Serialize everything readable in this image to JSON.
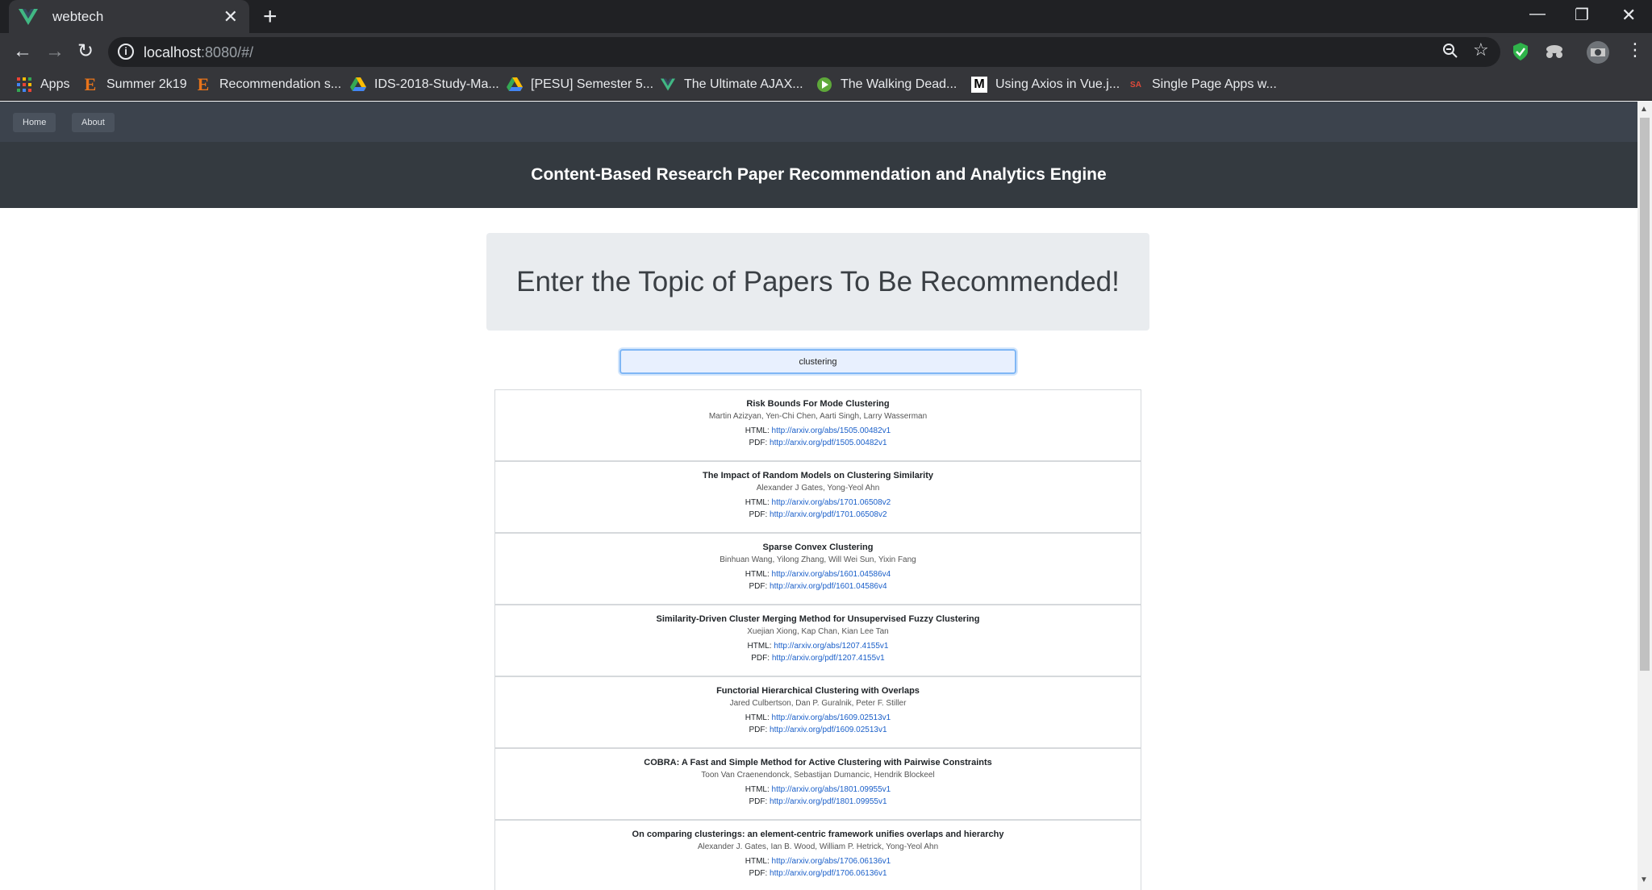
{
  "browser": {
    "tab_title": "webtech",
    "new_tab": "+",
    "tab_close": "✕",
    "url_host": "localhost",
    "url_rest": ":8080/#/",
    "bookmarks": [
      {
        "label": "Apps",
        "icon": "apps-grid-icon"
      },
      {
        "label": "Summer 2k19",
        "icon": "e-icon"
      },
      {
        "label": "Recommendation s...",
        "icon": "e-icon"
      },
      {
        "label": "IDS-2018-Study-Ma...",
        "icon": "drive-icon"
      },
      {
        "label": "[PESU] Semester 5...",
        "icon": "drive-icon"
      },
      {
        "label": "The Ultimate AJAX...",
        "icon": "vue-icon"
      },
      {
        "label": "The Walking Dead...",
        "icon": "play-icon"
      },
      {
        "label": "Using Axios in Vue.j...",
        "icon": "medium-icon"
      },
      {
        "label": "Single Page Apps w...",
        "icon": "sa-icon"
      }
    ]
  },
  "site": {
    "nav": [
      "Home",
      "About"
    ],
    "banner_title": "Content-Based Research Paper Recommendation and Analytics Engine",
    "prompt": "Enter the Topic of Papers To Be Recommended!",
    "search_value": "clustering"
  },
  "results": [
    {
      "title": "Risk Bounds For Mode Clustering",
      "authors": "Martin Azizyan, Yen-Chi Chen, Aarti Singh, Larry Wasserman",
      "html": "http://arxiv.org/abs/1505.00482v1",
      "pdf": "http://arxiv.org/pdf/1505.00482v1"
    },
    {
      "title": "The Impact of Random Models on Clustering Similarity",
      "authors": "Alexander J Gates, Yong-Yeol Ahn",
      "html": "http://arxiv.org/abs/1701.06508v2",
      "pdf": "http://arxiv.org/pdf/1701.06508v2"
    },
    {
      "title": "Sparse Convex Clustering",
      "authors": "Binhuan Wang, Yilong Zhang, Will Wei Sun, Yixin Fang",
      "html": "http://arxiv.org/abs/1601.04586v4",
      "pdf": "http://arxiv.org/pdf/1601.04586v4"
    },
    {
      "title": "Similarity-Driven Cluster Merging Method for Unsupervised Fuzzy Clustering",
      "authors": "Xuejian Xiong, Kap Chan, Kian Lee Tan",
      "html": "http://arxiv.org/abs/1207.4155v1",
      "pdf": "http://arxiv.org/pdf/1207.4155v1"
    },
    {
      "title": "Functorial Hierarchical Clustering with Overlaps",
      "authors": "Jared Culbertson, Dan P. Guralnik, Peter F. Stiller",
      "html": "http://arxiv.org/abs/1609.02513v1",
      "pdf": "http://arxiv.org/pdf/1609.02513v1"
    },
    {
      "title": "COBRA: A Fast and Simple Method for Active Clustering with Pairwise Constraints",
      "authors": "Toon Van Craenendonck, Sebastijan Dumancic, Hendrik Blockeel",
      "html": "http://arxiv.org/abs/1801.09955v1",
      "pdf": "http://arxiv.org/pdf/1801.09955v1"
    },
    {
      "title": "On comparing clusterings: an element-centric framework unifies overlaps and hierarchy",
      "authors": "Alexander J. Gates, Ian B. Wood, William P. Hetrick, Yong-Yeol Ahn",
      "html": "http://arxiv.org/abs/1706.06136v1",
      "pdf": "http://arxiv.org/pdf/1706.06136v1"
    }
  ],
  "labels": {
    "html_prefix": "HTML:",
    "pdf_prefix": "PDF:"
  }
}
